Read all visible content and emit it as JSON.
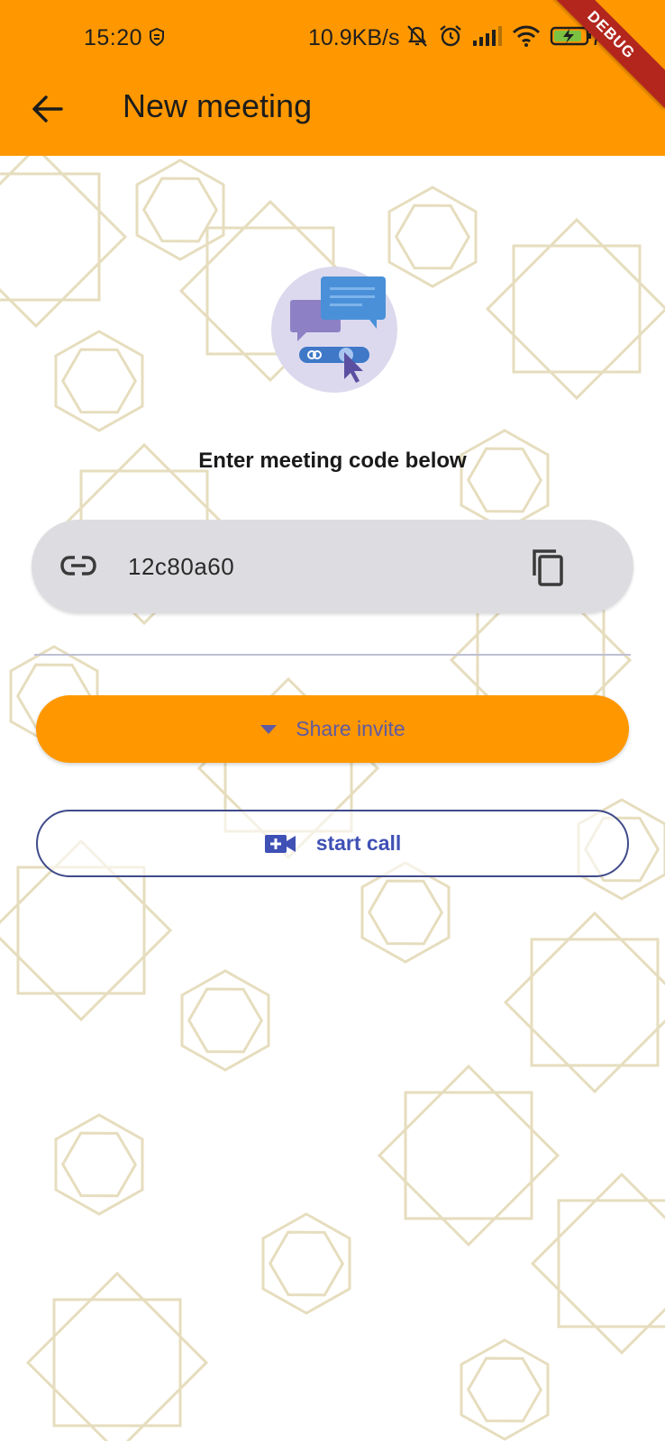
{
  "status_bar": {
    "time": "15:20",
    "network_speed": "10.9KB/s",
    "battery_percent": "79",
    "icons": [
      "shield-icon",
      "mute-bell-icon",
      "alarm-icon",
      "signal-icon",
      "wifi-icon",
      "battery-charging-icon"
    ]
  },
  "debug_banner": "DEBUG",
  "app_bar": {
    "title": "New meeting",
    "back_icon": "arrow-back-icon"
  },
  "main": {
    "heading": "Enter meeting code below",
    "meeting_code": "12c80a60",
    "code_icon": "link-icon",
    "copy_icon": "copy-icon",
    "share_button": {
      "label": "Share invite",
      "icon": "dropdown-arrow-icon"
    },
    "call_button": {
      "label": "start call",
      "icon": "video-call-icon"
    }
  },
  "colors": {
    "accent": "#FF9800",
    "primary": "#3F51B5",
    "field_bg": "#DDDDE1",
    "debug": "#B3261E"
  }
}
